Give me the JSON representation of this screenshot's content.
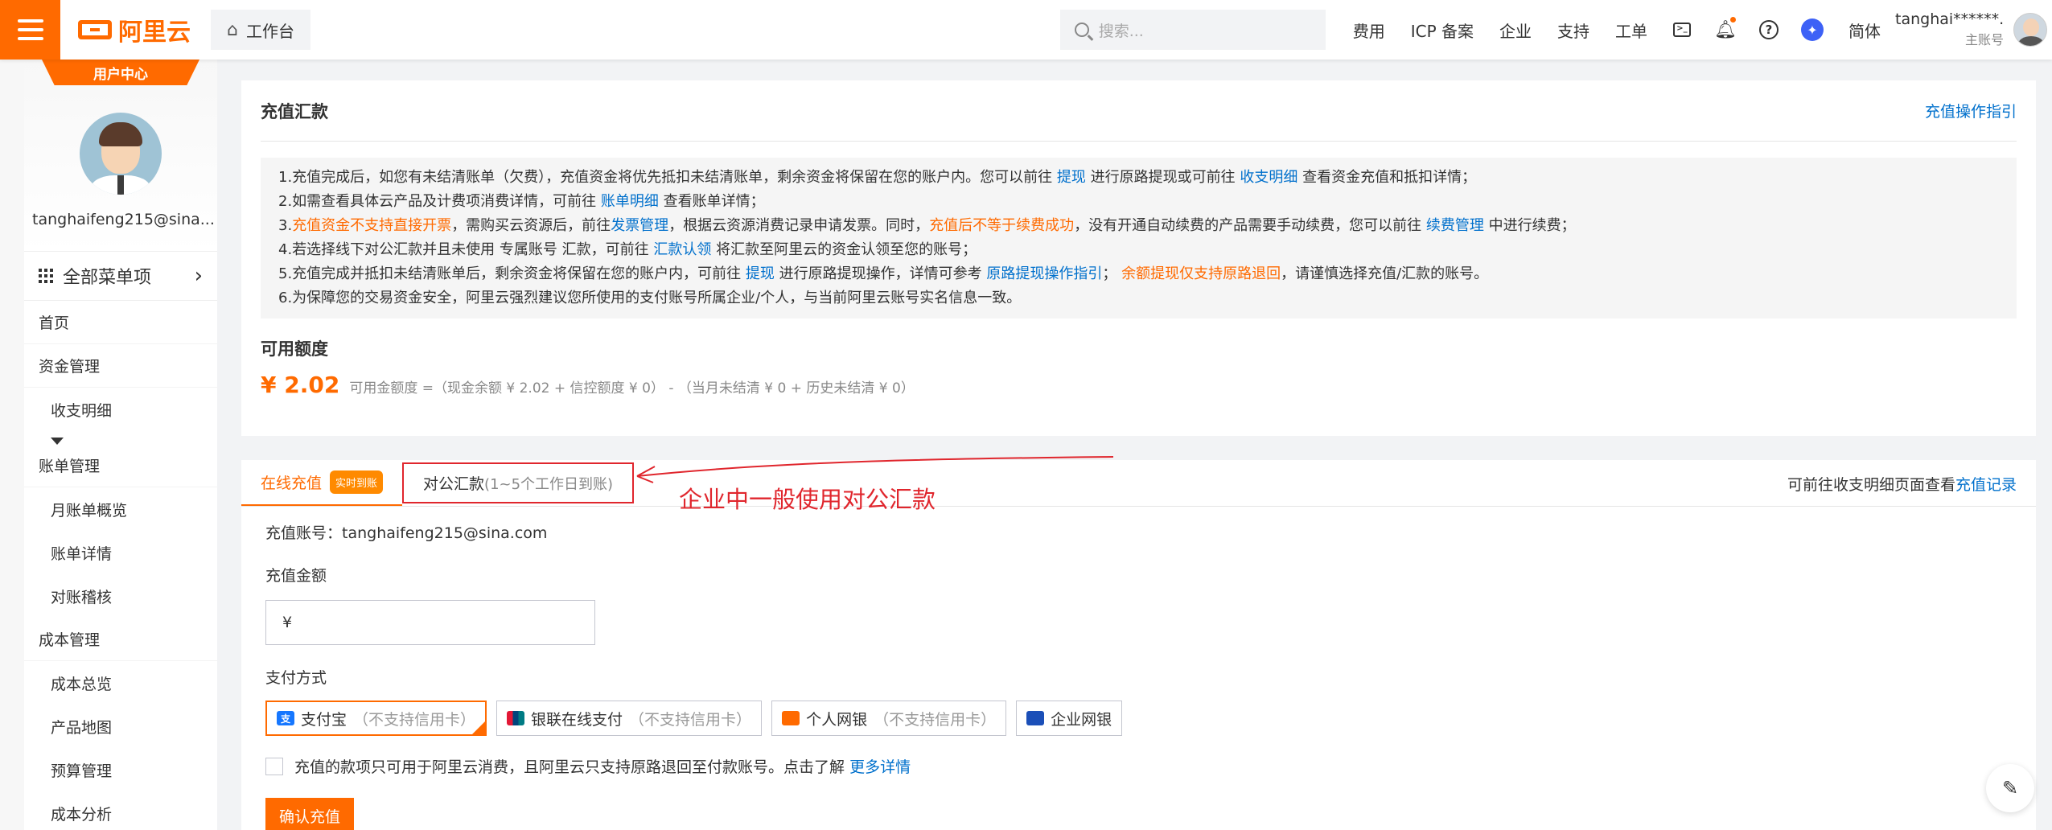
{
  "topbar": {
    "brand": "阿里云",
    "workbench": "工作台",
    "search_placeholder": "搜索...",
    "links": [
      "费用",
      "ICP 备案",
      "企业",
      "支持",
      "工单"
    ],
    "lang": "简体",
    "user_name": "tanghai******...",
    "user_role": "主账号",
    "icons": [
      "menu-icon",
      "home-icon",
      "search-icon",
      "terminal-icon",
      "bell-icon",
      "help-icon",
      "star-icon"
    ]
  },
  "sidebar": {
    "tab": "用户中心",
    "email": "tanghaifeng215@sina...",
    "all_menu": "全部菜单项",
    "items": [
      {
        "label": "首页",
        "level": 1
      },
      {
        "label": "资金管理",
        "level": 1
      },
      {
        "label": "收支明细",
        "level": 2
      },
      {
        "label": "账单管理",
        "level": 1
      },
      {
        "label": "月账单概览",
        "level": 2
      },
      {
        "label": "账单详情",
        "level": 2
      },
      {
        "label": "对账稽核",
        "level": 2
      },
      {
        "label": "成本管理",
        "level": 1
      },
      {
        "label": "成本总览",
        "level": 2
      },
      {
        "label": "产品地图",
        "level": 2
      },
      {
        "label": "预算管理",
        "level": 2
      },
      {
        "label": "成本分析",
        "level": 2
      }
    ]
  },
  "recharge": {
    "title": "充值汇款",
    "guide_link": "充值操作指引",
    "notice": {
      "l1_a": "1.充值完成后，如您有未结清账单（欠费），充值资金将优先抵扣未结清账单，剩余资金将保留在您的账户内。您可以前往",
      "l1_link1": "提现",
      "l1_b": "进行原路提现或可前往",
      "l1_link2": "收支明细",
      "l1_c": "查看资金充值和抵扣详情；",
      "l2_a": "2.如需查看具体云产品及计费项消费详情，可前往",
      "l2_link": "账单明细",
      "l2_b": "查看账单详情；",
      "l3_a": "3.",
      "l3_orange1": "充值资金不支持直接开票",
      "l3_b": "，需购买云资源后，前往",
      "l3_link1": "发票管理",
      "l3_c": "，根据云资源消费记录申请发票。同时，",
      "l3_orange2": "充值后不等于续费成功",
      "l3_d": "，没有开通自动续费的产品需要手动续费，您可以前往",
      "l3_link2": "续费管理",
      "l3_e": "中进行续费；",
      "l4_a": "4.若选择线下对公汇款并且未使用 专属账号 汇款，可前往",
      "l4_link": "汇款认领",
      "l4_b": "将汇款至阿里云的资金认领至您的账号；",
      "l5_a": "5.充值完成并抵扣未结清账单后，剩余资金将保留在您的账户内，可前往",
      "l5_link1": "提现",
      "l5_b": "进行原路提现操作，详情可参考",
      "l5_link2": "原路提现操作指引",
      "l5_c": "；",
      "l5_orange": "余额提现仅支持原路退回",
      "l5_d": "，请谨慎选择充值/汇款的账号。",
      "l6": "6.为保障您的交易资金安全，阿里云强烈建议您所使用的支付账号所属企业/个人，与当前阿里云账号实名信息一致。"
    },
    "quota_title": "可用额度",
    "quota_amount": "¥ 2.02",
    "quota_desc": "可用金额度 =（现金余额 ¥ 2.02 + 信控额度 ¥ 0） - （当月未结清 ¥ 0 + 历史未结清 ¥ 0）"
  },
  "tabs": {
    "online": "在线充值",
    "online_badge": "实时到账",
    "corporate": "对公汇款",
    "corporate_note": "(1~5个工作日到账)",
    "annotation": "企业中一般使用对公汇款",
    "right_text": "可前往收支明细页面查看",
    "right_link": "充值记录"
  },
  "form": {
    "account_label": "充值账号：",
    "account_value": "tanghaifeng215@sina.com",
    "amount_label": "充值金额",
    "amount_prefix": "¥",
    "pay_label": "支付方式",
    "pay_options": [
      {
        "label": "支付宝",
        "note": "（不支持信用卡）",
        "icon": "alipay-icon",
        "selected": true
      },
      {
        "label": "银联在线支付",
        "note": "（不支持信用卡）",
        "icon": "unionpay-icon",
        "selected": false
      },
      {
        "label": "个人网银",
        "note": "（不支持信用卡）",
        "icon": "personal-bank-icon",
        "selected": false
      },
      {
        "label": "企业网银",
        "note": "",
        "icon": "corporate-bank-icon",
        "selected": false
      }
    ],
    "agree_text": "充值的款项只可用于阿里云消费，且阿里云只支持原路退回至付款账号。点击了解",
    "agree_link": "更多详情",
    "confirm": "确认充值"
  },
  "colors": {
    "accent": "#ff6a00",
    "link": "#0070cc",
    "annotation": "#e0262d"
  }
}
